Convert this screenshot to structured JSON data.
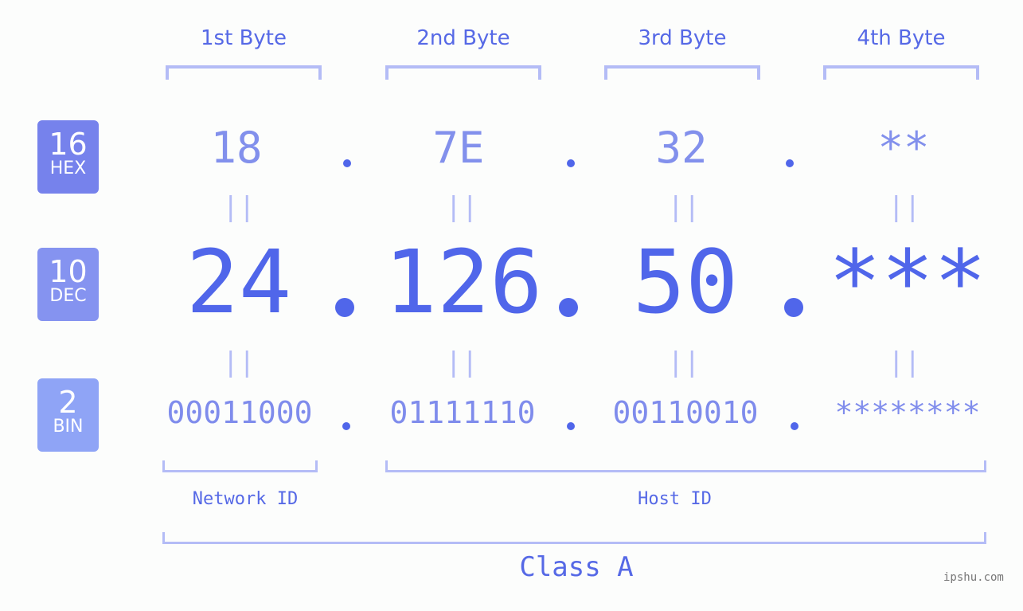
{
  "bytes": [
    {
      "label": "1st Byte",
      "hex": "18",
      "dec": "24",
      "bin": "00011000"
    },
    {
      "label": "2nd Byte",
      "hex": "7E",
      "dec": "126",
      "bin": "01111110"
    },
    {
      "label": "3rd Byte",
      "hex": "32",
      "dec": "50",
      "bin": "00110010"
    },
    {
      "label": "4th Byte",
      "hex": "**",
      "dec": "***",
      "bin": "********"
    }
  ],
  "badges": {
    "hex": {
      "num": "16",
      "label": "HEX",
      "color": "#7682ec"
    },
    "dec": {
      "num": "10",
      "label": "DEC",
      "color": "#8593f0"
    },
    "bin": {
      "num": "2",
      "label": "BIN",
      "color": "#8fa4f6"
    }
  },
  "equals_sign": "||",
  "network_id_label": "Network ID",
  "host_id_label": "Host ID",
  "class_label": "Class A",
  "watermark": "ipshu.com",
  "colors": {
    "accent": "#5066ea",
    "bracket": "#b4bcf6"
  }
}
